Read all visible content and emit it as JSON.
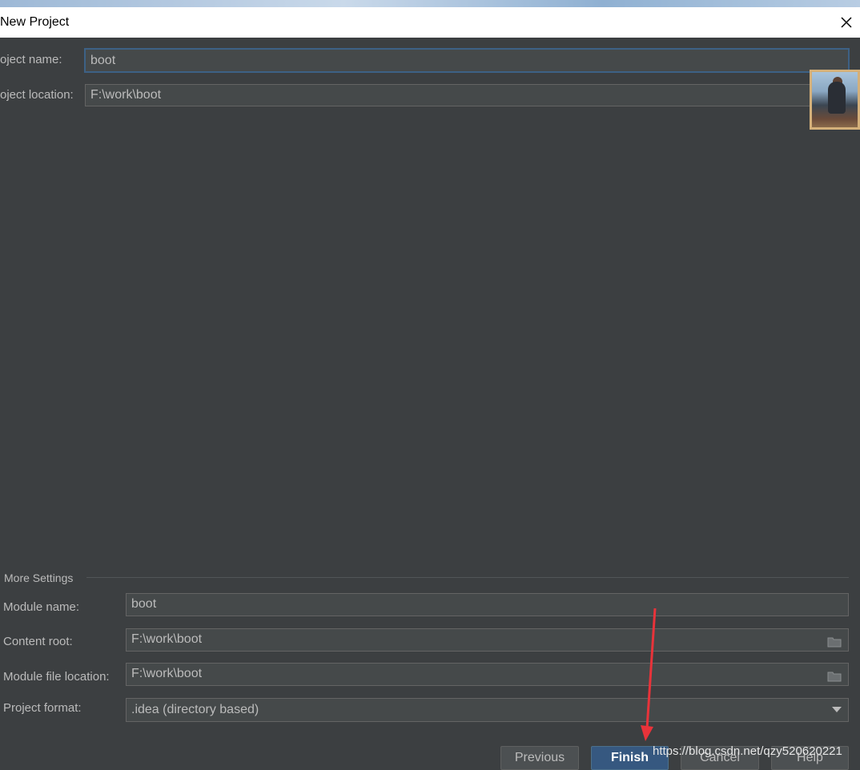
{
  "window": {
    "title": "New Project"
  },
  "project": {
    "name_label": "oject name:",
    "name_value": "boot",
    "location_label": "oject location:",
    "location_value": "F:\\work\\boot"
  },
  "more_settings": {
    "header": "More Settings",
    "module_name_label": "Module name:",
    "module_name_value": "boot",
    "content_root_label": "Content root:",
    "content_root_value": "F:\\work\\boot",
    "module_file_label": "Module file location:",
    "module_file_value": "F:\\work\\boot",
    "format_label": "Project format:",
    "format_value": ".idea (directory based)"
  },
  "buttons": {
    "previous": "Previous",
    "finish": "Finish",
    "cancel": "Cancel",
    "help": "Help"
  },
  "watermark": "https://blog.csdn.net/qzy520620221",
  "colors": {
    "background": "#3c3f41",
    "field": "#45494a",
    "primary_button": "#365880",
    "annotation_arrow": "#e8333a"
  }
}
